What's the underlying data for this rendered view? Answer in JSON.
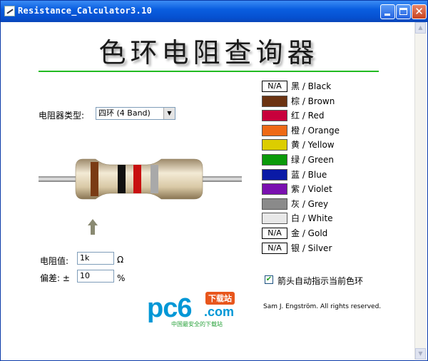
{
  "window": {
    "title": "Resistance_Calculator3.10"
  },
  "header": {
    "title": "色环电阻查询器"
  },
  "resistor_type": {
    "label": "电阻器类型:",
    "selected": "四环 (4 Band)"
  },
  "resistance": {
    "label": "电阻值:",
    "value": "1k",
    "unit": "Ω"
  },
  "tolerance": {
    "label": "偏差: ±",
    "value": "10",
    "unit": "%"
  },
  "bands": [
    {
      "name": "Brown",
      "color": "#7a3b14"
    },
    {
      "name": "Black",
      "color": "#111111"
    },
    {
      "name": "Red",
      "color": "#c81010"
    },
    {
      "name": "Silver",
      "color": "#a9a9a9"
    }
  ],
  "colors": [
    {
      "name": "黑 / Black",
      "color": "#000000",
      "na": true,
      "na_label": "N/A"
    },
    {
      "name": "棕 / Brown",
      "color": "#6b3312",
      "na": false
    },
    {
      "name": "红 / Red",
      "color": "#c8003c",
      "na": false
    },
    {
      "name": "橙 / Orange",
      "color": "#ee6a16",
      "na": false
    },
    {
      "name": "黄 / Yellow",
      "color": "#dccd00",
      "na": false
    },
    {
      "name": "绿 / Green",
      "color": "#0a9a0a",
      "na": false
    },
    {
      "name": "蓝 / Blue",
      "color": "#0a1aa6",
      "na": false
    },
    {
      "name": "紫 / Violet",
      "color": "#7a10b0",
      "na": false
    },
    {
      "name": "灰 / Grey",
      "color": "#8a8a8a",
      "na": false
    },
    {
      "name": "白 / White",
      "color": "#e8e8e8",
      "na": false
    },
    {
      "name": "金 / Gold",
      "color": "#c8a000",
      "na": true,
      "na_label": "N/A"
    },
    {
      "name": "银 / Silver",
      "color": "#c0c0c0",
      "na": true,
      "na_label": "N/A"
    }
  ],
  "options": {
    "arrow_indicator_label": "箭头自动指示当前色环",
    "arrow_indicator_checked": true
  },
  "footer": {
    "copyright": "Sam J. Engström. All rights reserved."
  },
  "watermark": {
    "brand": "pc6",
    "badge": "下载站",
    "domain": ".com",
    "slogan": "中国最安全的下载站"
  }
}
